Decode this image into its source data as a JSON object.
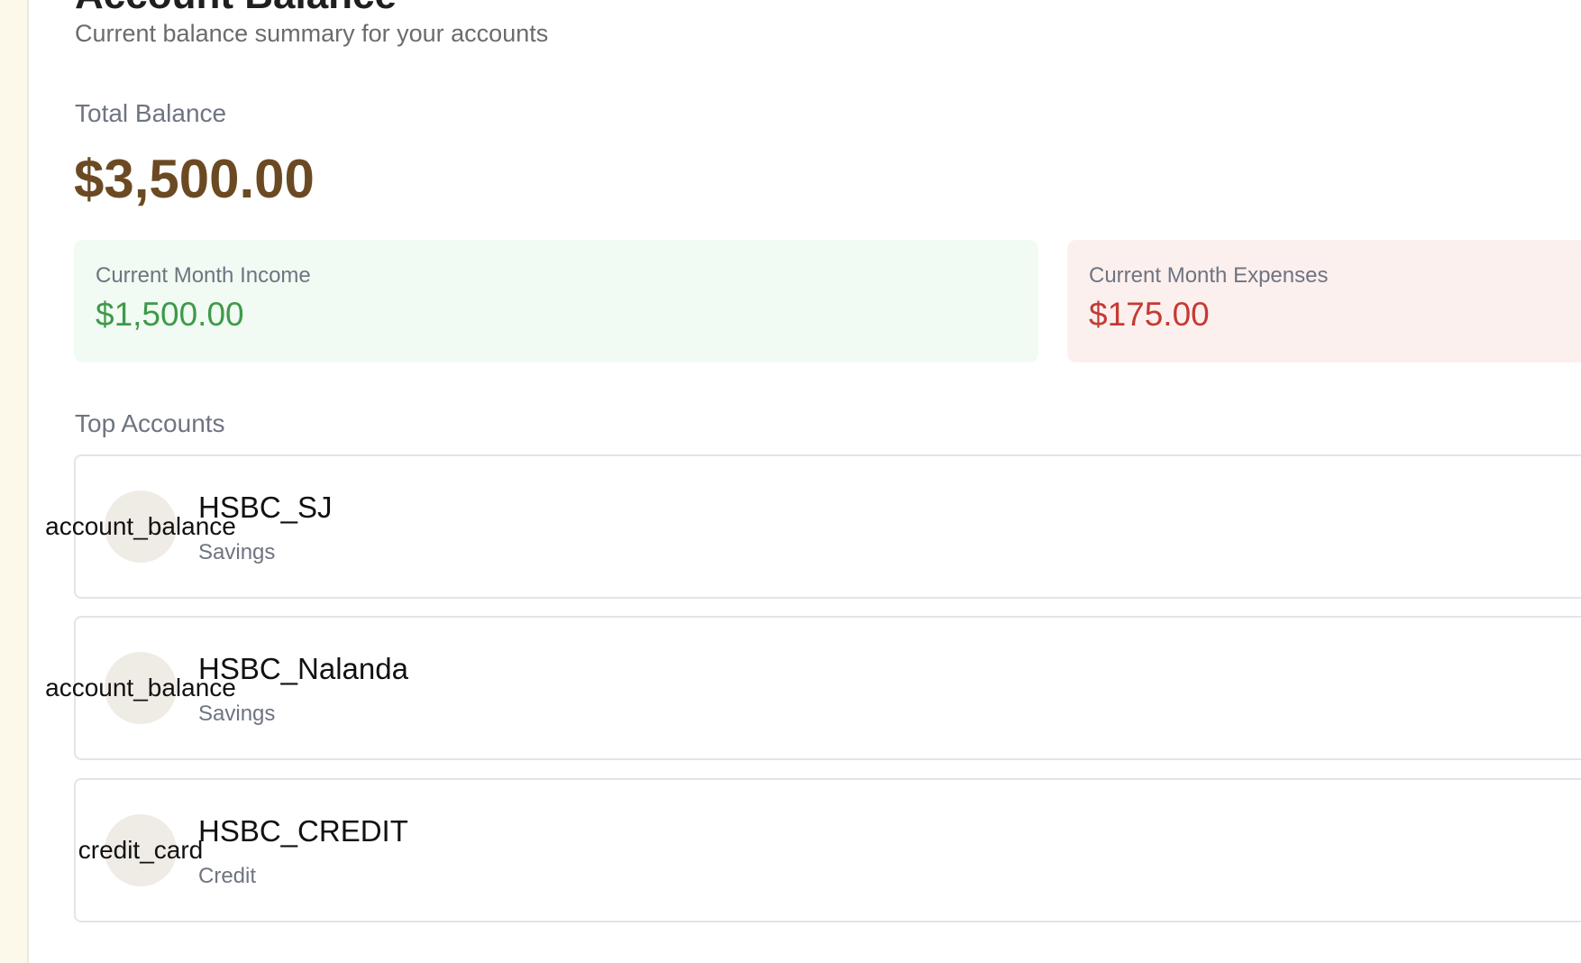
{
  "summary": {
    "title": "Account Balance",
    "subtitle": "Current balance summary for your accounts",
    "total_label": "Total Balance",
    "total_value": "$3,500.00",
    "income": {
      "label": "Current Month Income",
      "value": "$1,500.00",
      "color": "#3e9a49"
    },
    "expenses": {
      "label": "Current Month Expenses",
      "value": "$175.00",
      "color": "#c53a33"
    }
  },
  "top_accounts": {
    "title": "Top Accounts",
    "items": [
      {
        "icon": "account_balance",
        "name": "HSBC_SJ",
        "type": "Savings"
      },
      {
        "icon": "account_balance",
        "name": "HSBC_Nalanda",
        "type": "Savings"
      },
      {
        "icon": "credit_card",
        "name": "HSBC_CREDIT",
        "type": "Credit"
      }
    ]
  }
}
